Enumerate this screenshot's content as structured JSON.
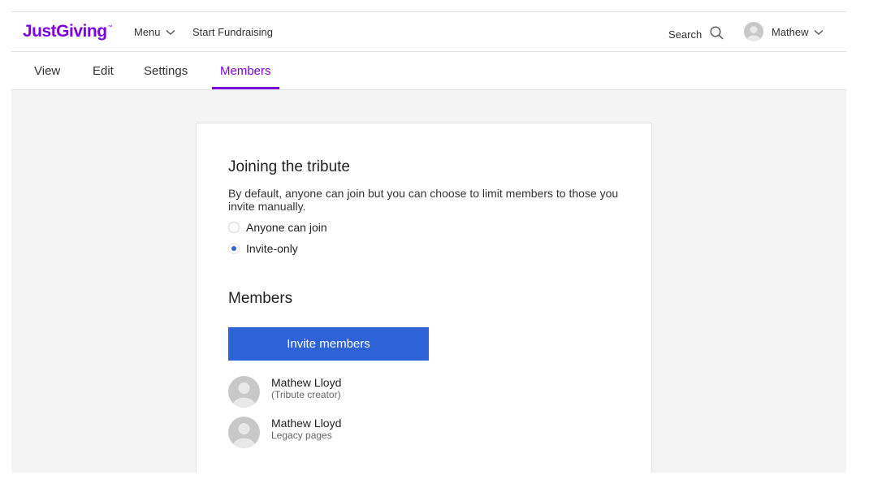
{
  "header": {
    "logo": "JustGiving",
    "logo_tm": "™",
    "menu_label": "Menu",
    "start_fundraising_label": "Start Fundraising",
    "search_label": "Search",
    "user_label": "Mathew"
  },
  "tabs": [
    {
      "label": "View",
      "active": false
    },
    {
      "label": "Edit",
      "active": false
    },
    {
      "label": "Settings",
      "active": false
    },
    {
      "label": "Members",
      "active": true
    }
  ],
  "joining": {
    "title": "Joining the tribute",
    "description": "By default, anyone can join but you can choose to limit members to those you invite manually.",
    "options": [
      {
        "label": "Anyone can join",
        "selected": false
      },
      {
        "label": "Invite-only",
        "selected": true
      }
    ]
  },
  "members": {
    "title": "Members",
    "invite_button": "Invite members",
    "list": [
      {
        "name": "Mathew Lloyd",
        "subtitle": "(Tribute creator)"
      },
      {
        "name": "Mathew Lloyd",
        "subtitle": "Legacy pages"
      }
    ]
  },
  "colors": {
    "brand": "#7a04dd",
    "primary_button": "#2d63d6",
    "radio_selected": "#2f64d6",
    "page_bg": "#f4f4f4"
  },
  "icons": {
    "menu_chevron": "chevron-down-icon",
    "search": "search-icon",
    "user_chevron": "chevron-down-icon",
    "avatar": "avatar-placeholder-icon"
  }
}
